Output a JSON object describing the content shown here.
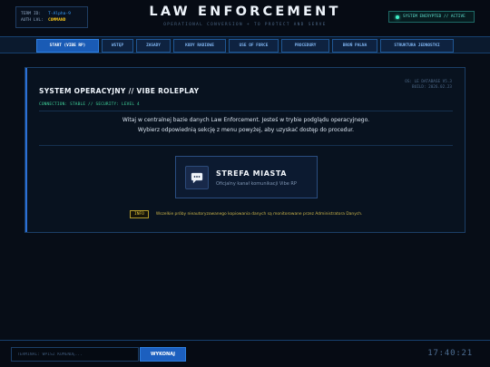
{
  "header": {
    "term": {
      "id_label": "TERM ID:",
      "id_value": "T-Alpha-9",
      "auth_label": "AUTH LVL:",
      "auth_value": "COMMAND"
    },
    "title": "LAW ENFORCEMENT",
    "subtitle": "OPERATIONAL CONVERSION + TO PROTECT AND SERVE",
    "status": "SYSTEM ENCRYPTED // ACTIVE"
  },
  "nav": {
    "tabs": [
      {
        "label": "START (VIBE RP)",
        "active": true
      },
      {
        "label": "WSTĘP",
        "active": false
      },
      {
        "label": "ZASADY",
        "active": false
      },
      {
        "label": "KODY RADIOWE",
        "active": false
      },
      {
        "label": "USE OF FORCE",
        "active": false
      },
      {
        "label": "PROCEDURY",
        "active": false
      },
      {
        "label": "BROŃ PALNA",
        "active": false
      },
      {
        "label": "STRUKTURA JEDNOSTKI",
        "active": false
      }
    ]
  },
  "panel": {
    "title": "SYSTEM OPERACYJNY // VIBE ROLEPLAY",
    "connection": "CONNECTION: STABLE // SECURITY: LEVEL 4",
    "meta_line1": "OS: LE DATABASE V5.3",
    "meta_line2": "BUILD: 2026.02.23",
    "welcome_line1": "Witaj w centralnej bazie danych Law Enforcement. Jesteś w trybie podglądu operacyjnego.",
    "welcome_line2": "Wybierz odpowiednią sekcję z menu powyżej, aby uzyskać dostęp do procedur.",
    "card": {
      "icon": "chat-bubble-icon",
      "title": "STREFA MIASTA",
      "subtitle": "Oficjalny kanał komunikacji Vibe RP"
    },
    "info_badge": "INFO",
    "info_text": "Wszelkie próby nieautoryzowanego kopiowania danych są monitorowane przez Administratora Danych."
  },
  "footer": {
    "placeholder": "TERMINAL: WPISZ KOMENDĘ...",
    "button": "WYKONAJ",
    "clock": "17:40:21"
  },
  "colors": {
    "accent": "#1a5bb5",
    "status_green": "#3ff0c8",
    "warning_gold": "#e0c23a"
  }
}
